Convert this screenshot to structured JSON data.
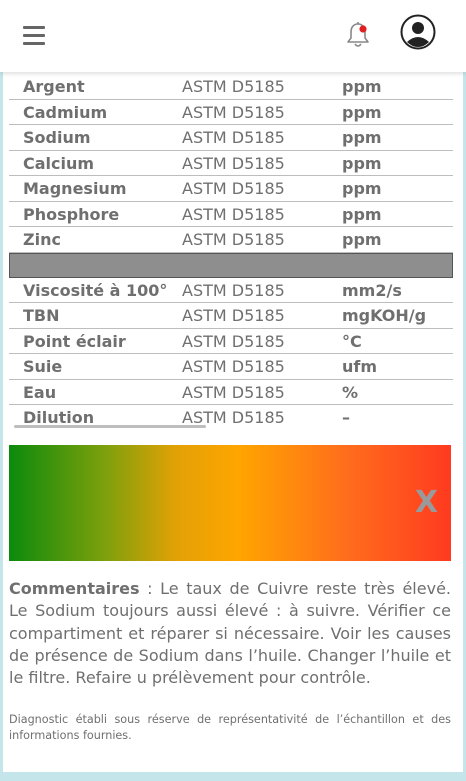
{
  "header": {
    "menu_icon": "hamburger-icon",
    "bell_icon": "bell-icon",
    "notification_color": "#e02020",
    "avatar_icon": "user-circle-icon"
  },
  "table": {
    "rows_top": [
      {
        "name": "Argent",
        "method": "ASTM D5185",
        "unit": "ppm"
      },
      {
        "name": "Cadmium",
        "method": "ASTM D5185",
        "unit": "ppm"
      },
      {
        "name": "Sodium",
        "method": "ASTM D5185",
        "unit": "ppm"
      },
      {
        "name": "Calcium",
        "method": "ASTM D5185",
        "unit": "ppm"
      },
      {
        "name": "Magnesium",
        "method": "ASTM D5185",
        "unit": "ppm"
      },
      {
        "name": "Phosphore",
        "method": "ASTM D5185",
        "unit": "ppm"
      },
      {
        "name": "Zinc",
        "method": "ASTM D5185",
        "unit": "ppm"
      }
    ],
    "rows_bottom": [
      {
        "name": "Viscosité à 100°",
        "method": "ASTM D5185",
        "unit": "mm2/s"
      },
      {
        "name": "TBN",
        "method": "ASTM D5185",
        "unit": "mgKOH/g"
      },
      {
        "name": "Point éclair",
        "method": "ASTM D5185",
        "unit": "°C"
      },
      {
        "name": "Suie",
        "method": "ASTM D5185",
        "unit": "ufm"
      },
      {
        "name": "Eau",
        "method": "ASTM D5185",
        "unit": "%"
      },
      {
        "name": "Dilution",
        "method": "ASTM D5185",
        "unit": "–"
      }
    ]
  },
  "gauge": {
    "marker": "X",
    "colors": [
      "#0c8a0c",
      "#ffa500",
      "#ff3a20"
    ]
  },
  "comment": {
    "label": "Commentaires",
    "text": " : Le taux de Cuivre reste très élevé. Le Sodium toujours aussi élevé : à suivre. Vérifier ce compartiment et réparer si nécessaire. Voir les causes de présence de Sodium dans l’huile. Changer l’huile et le filtre. Refaire u prélèvement pour contrôle."
  },
  "note": "Diagnostic établi sous réserve de représentativité de l’échantillon et des informations fournies."
}
